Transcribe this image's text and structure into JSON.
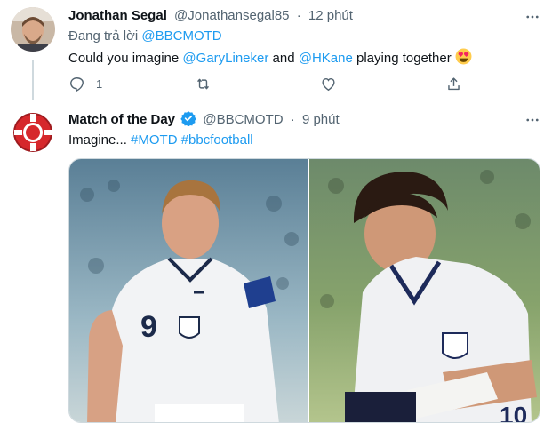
{
  "reply": {
    "name": "Jonathan Segal",
    "handle": "@Jonathansegal85",
    "dot": "·",
    "time": "12 phút",
    "replying_prefix": "Đang trả lời ",
    "replying_to": "@BBCMOTD",
    "text_part1": "Could you imagine ",
    "mention1": "@GaryLineker",
    "text_part2": " and ",
    "mention2": "@HKane",
    "text_part3": " playing together ",
    "emoji": "heart-eyes-emoji",
    "reply_count": "1"
  },
  "original": {
    "name": "Match of the Day",
    "handle": "@BBCMOTD",
    "dot": "·",
    "time": "9 phút",
    "text_part1": "Imagine... ",
    "hashtag1": "#MOTD",
    "space": " ",
    "hashtag2": "#bbcfootball"
  },
  "colors": {
    "accent": "#1d9bf0",
    "secondary_text": "#536471",
    "primary_text": "#0f1419",
    "logo_red": "#d6282c"
  }
}
